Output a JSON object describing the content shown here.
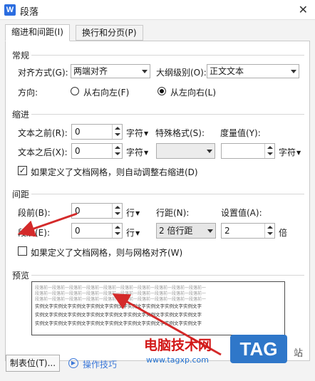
{
  "window": {
    "title": "段落",
    "app_icon": "wps-writer-icon",
    "app_icon_letter": "W"
  },
  "tabs": [
    {
      "label": "缩进和间距(I)",
      "active": true
    },
    {
      "label": "换行和分页(P)",
      "active": false
    }
  ],
  "general": {
    "title": "常规",
    "alignment_label": "对齐方式(G):",
    "alignment_value": "两端对齐",
    "outline_label": "大纲级别(O):",
    "outline_value": "正文文本",
    "direction_label": "方向:",
    "rtl_label": "从右向左(F)",
    "ltr_label": "从左向右(L)",
    "direction_selected": "ltr"
  },
  "indent": {
    "title": "缩进",
    "before_label": "文本之前(R):",
    "before_value": "0",
    "before_unit": "字符",
    "after_label": "文本之后(X):",
    "after_value": "0",
    "after_unit": "字符",
    "special_label": "特殊格式(S):",
    "special_value": "",
    "measure_label": "度量值(Y):",
    "measure_value": "",
    "measure_unit": "字符",
    "auto_adjust_label": "如果定义了文档网格，则自动调整右缩进(D)",
    "auto_adjust_checked": true
  },
  "spacing": {
    "title": "间距",
    "before_label": "段前(B):",
    "before_value": "0",
    "before_unit": "行",
    "after_label": "段后(E):",
    "after_value": "0",
    "after_unit": "行",
    "line_label": "行距(N):",
    "line_value": "2 倍行距",
    "setting_label": "设置值(A):",
    "setting_value": "2",
    "setting_unit": "倍",
    "grid_align_label": "如果定义了文档网格，则与网格对齐(W)",
    "grid_align_checked": false
  },
  "preview": {
    "title": "预览",
    "prev_text": "段落前一段落前一段落前一段落前一段落前一段落前一段落前一段落前一段落前一段落前一",
    "sample_text": "实例文字实例文字实例文字实例文字实例文字实例文字实例文字实例文字实例文字"
  },
  "footer": {
    "tabs_button": "制表位(T)...",
    "tips_label": "操作技巧"
  },
  "watermark": {
    "site_name": "电脑技术网",
    "url": "www.tagxp.com",
    "tag": "TAG",
    "suffix": "站"
  },
  "colors": {
    "annotation_arrow": "#d42a2a",
    "watermark_red": "#d21818",
    "watermark_blue": "#2f77c9"
  }
}
